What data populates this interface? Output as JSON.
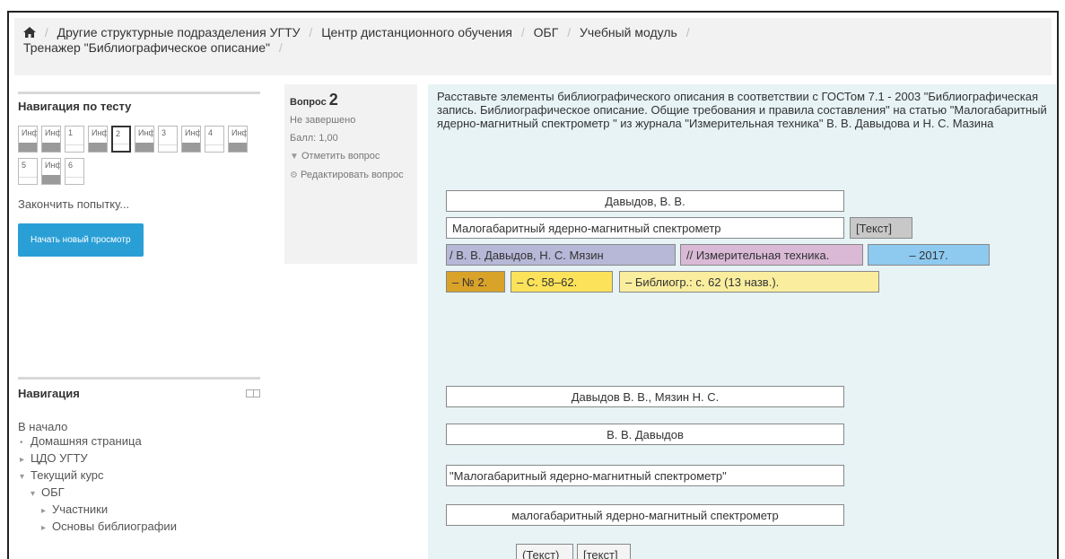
{
  "breadcrumb": {
    "items": [
      "Другие структурные подразделения УГТУ",
      "Центр дистанционного обучения",
      "ОБГ",
      "Учебный модуль"
    ],
    "last": "Тренажер \"Библиографическое описание\""
  },
  "quiz_nav": {
    "title": "Навигация по тесту",
    "buttons": [
      {
        "label": "Инф",
        "type": "info"
      },
      {
        "label": "Инф",
        "type": "info"
      },
      {
        "label": "1",
        "type": "num"
      },
      {
        "label": "Инф",
        "type": "info"
      },
      {
        "label": "2",
        "type": "num",
        "current": true
      },
      {
        "label": "Инф",
        "type": "info"
      },
      {
        "label": "3",
        "type": "num"
      },
      {
        "label": "Инф",
        "type": "info"
      },
      {
        "label": "4",
        "type": "num"
      },
      {
        "label": "Инф",
        "type": "info"
      },
      {
        "label": "5",
        "type": "num"
      },
      {
        "label": "Инф",
        "type": "info"
      },
      {
        "label": "6",
        "type": "num"
      }
    ],
    "finish_link": "Закончить попытку...",
    "restart_button": "Начать новый просмотр"
  },
  "navigation": {
    "title": "Навигация",
    "home": "В начало",
    "items": [
      {
        "label": "Домашняя страница",
        "bullet": "•",
        "indent": 1
      },
      {
        "label": "ЦДО УГТУ",
        "bullet": "▸",
        "indent": 1
      },
      {
        "label": "Текущий курс",
        "bullet": "▾",
        "indent": 1
      },
      {
        "label": "ОБГ",
        "bullet": "▾",
        "indent": 2
      },
      {
        "label": "Участники",
        "bullet": "▸",
        "indent": 3
      },
      {
        "label": "Основы библиографии",
        "bullet": "▸",
        "indent": 3
      }
    ]
  },
  "question_info": {
    "label": "Вопрос",
    "number": "2",
    "state": "Не завершено",
    "grade": "Балл: 1,00",
    "flag": "Отметить вопрос",
    "edit": "Редактировать вопрос"
  },
  "question": {
    "text": "Расставьте элементы библиографического описания в соответствии с ГОСТом 7.1 - 2003 \"Библиографическая запись. Библиографическое описание. Общие требования и правила составления\" на статью \"Малогабаритный ядерно-магнитный спектрометр \" из журнала \"Измерительная техника\" В. В. Давыдова и Н. С. Мазина",
    "placed": [
      {
        "text": "Давыдов, В. В.",
        "color": "white"
      },
      {
        "text": "Малогабаритный ядерно-магнитный спектрометр",
        "color": "white"
      },
      {
        "text": "[Текст]",
        "color": "gray"
      },
      {
        "text": "/ В. В. Давыдов, Н. С. Мязин",
        "color": "lilac"
      },
      {
        "text": "// Измерительная техника.",
        "color": "pink"
      },
      {
        "text": "– 2017.",
        "color": "blue"
      },
      {
        "text": "– № 2.",
        "color": "orange"
      },
      {
        "text": "– С. 58–62.",
        "color": "yellow"
      },
      {
        "text": "– Библиогр.: с. 62 (13 назв.).",
        "color": "cream"
      }
    ],
    "choices": [
      {
        "text": "Давыдов В. В., Мязин Н. С."
      },
      {
        "text": "В. В. Давыдов"
      },
      {
        "text": "\"Малогабаритный ядерно-магнитный спектрометр\""
      },
      {
        "text": "малогабаритный ядерно-магнитный спектрометр"
      },
      {
        "text": "(Текст)"
      },
      {
        "text": "[текст]"
      }
    ]
  }
}
